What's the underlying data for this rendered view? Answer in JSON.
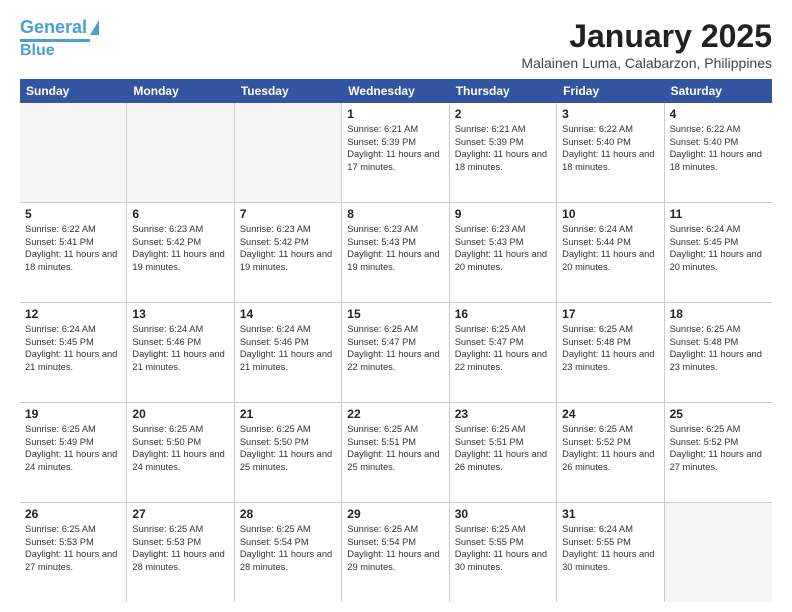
{
  "header": {
    "logo_line1": "General",
    "logo_line2": "Blue",
    "month_title": "January 2025",
    "subtitle": "Malainen Luma, Calabarzon, Philippines"
  },
  "days_of_week": [
    "Sunday",
    "Monday",
    "Tuesday",
    "Wednesday",
    "Thursday",
    "Friday",
    "Saturday"
  ],
  "weeks": [
    [
      {
        "day": "",
        "sunrise": "",
        "sunset": "",
        "daylight": "",
        "empty": true
      },
      {
        "day": "",
        "sunrise": "",
        "sunset": "",
        "daylight": "",
        "empty": true
      },
      {
        "day": "",
        "sunrise": "",
        "sunset": "",
        "daylight": "",
        "empty": true
      },
      {
        "day": "1",
        "sunrise": "Sunrise: 6:21 AM",
        "sunset": "Sunset: 5:39 PM",
        "daylight": "Daylight: 11 hours and 17 minutes.",
        "empty": false
      },
      {
        "day": "2",
        "sunrise": "Sunrise: 6:21 AM",
        "sunset": "Sunset: 5:39 PM",
        "daylight": "Daylight: 11 hours and 18 minutes.",
        "empty": false
      },
      {
        "day": "3",
        "sunrise": "Sunrise: 6:22 AM",
        "sunset": "Sunset: 5:40 PM",
        "daylight": "Daylight: 11 hours and 18 minutes.",
        "empty": false
      },
      {
        "day": "4",
        "sunrise": "Sunrise: 6:22 AM",
        "sunset": "Sunset: 5:40 PM",
        "daylight": "Daylight: 11 hours and 18 minutes.",
        "empty": false
      }
    ],
    [
      {
        "day": "5",
        "sunrise": "Sunrise: 6:22 AM",
        "sunset": "Sunset: 5:41 PM",
        "daylight": "Daylight: 11 hours and 18 minutes.",
        "empty": false
      },
      {
        "day": "6",
        "sunrise": "Sunrise: 6:23 AM",
        "sunset": "Sunset: 5:42 PM",
        "daylight": "Daylight: 11 hours and 19 minutes.",
        "empty": false
      },
      {
        "day": "7",
        "sunrise": "Sunrise: 6:23 AM",
        "sunset": "Sunset: 5:42 PM",
        "daylight": "Daylight: 11 hours and 19 minutes.",
        "empty": false
      },
      {
        "day": "8",
        "sunrise": "Sunrise: 6:23 AM",
        "sunset": "Sunset: 5:43 PM",
        "daylight": "Daylight: 11 hours and 19 minutes.",
        "empty": false
      },
      {
        "day": "9",
        "sunrise": "Sunrise: 6:23 AM",
        "sunset": "Sunset: 5:43 PM",
        "daylight": "Daylight: 11 hours and 20 minutes.",
        "empty": false
      },
      {
        "day": "10",
        "sunrise": "Sunrise: 6:24 AM",
        "sunset": "Sunset: 5:44 PM",
        "daylight": "Daylight: 11 hours and 20 minutes.",
        "empty": false
      },
      {
        "day": "11",
        "sunrise": "Sunrise: 6:24 AM",
        "sunset": "Sunset: 5:45 PM",
        "daylight": "Daylight: 11 hours and 20 minutes.",
        "empty": false
      }
    ],
    [
      {
        "day": "12",
        "sunrise": "Sunrise: 6:24 AM",
        "sunset": "Sunset: 5:45 PM",
        "daylight": "Daylight: 11 hours and 21 minutes.",
        "empty": false
      },
      {
        "day": "13",
        "sunrise": "Sunrise: 6:24 AM",
        "sunset": "Sunset: 5:46 PM",
        "daylight": "Daylight: 11 hours and 21 minutes.",
        "empty": false
      },
      {
        "day": "14",
        "sunrise": "Sunrise: 6:24 AM",
        "sunset": "Sunset: 5:46 PM",
        "daylight": "Daylight: 11 hours and 21 minutes.",
        "empty": false
      },
      {
        "day": "15",
        "sunrise": "Sunrise: 6:25 AM",
        "sunset": "Sunset: 5:47 PM",
        "daylight": "Daylight: 11 hours and 22 minutes.",
        "empty": false
      },
      {
        "day": "16",
        "sunrise": "Sunrise: 6:25 AM",
        "sunset": "Sunset: 5:47 PM",
        "daylight": "Daylight: 11 hours and 22 minutes.",
        "empty": false
      },
      {
        "day": "17",
        "sunrise": "Sunrise: 6:25 AM",
        "sunset": "Sunset: 5:48 PM",
        "daylight": "Daylight: 11 hours and 23 minutes.",
        "empty": false
      },
      {
        "day": "18",
        "sunrise": "Sunrise: 6:25 AM",
        "sunset": "Sunset: 5:48 PM",
        "daylight": "Daylight: 11 hours and 23 minutes.",
        "empty": false
      }
    ],
    [
      {
        "day": "19",
        "sunrise": "Sunrise: 6:25 AM",
        "sunset": "Sunset: 5:49 PM",
        "daylight": "Daylight: 11 hours and 24 minutes.",
        "empty": false
      },
      {
        "day": "20",
        "sunrise": "Sunrise: 6:25 AM",
        "sunset": "Sunset: 5:50 PM",
        "daylight": "Daylight: 11 hours and 24 minutes.",
        "empty": false
      },
      {
        "day": "21",
        "sunrise": "Sunrise: 6:25 AM",
        "sunset": "Sunset: 5:50 PM",
        "daylight": "Daylight: 11 hours and 25 minutes.",
        "empty": false
      },
      {
        "day": "22",
        "sunrise": "Sunrise: 6:25 AM",
        "sunset": "Sunset: 5:51 PM",
        "daylight": "Daylight: 11 hours and 25 minutes.",
        "empty": false
      },
      {
        "day": "23",
        "sunrise": "Sunrise: 6:25 AM",
        "sunset": "Sunset: 5:51 PM",
        "daylight": "Daylight: 11 hours and 26 minutes.",
        "empty": false
      },
      {
        "day": "24",
        "sunrise": "Sunrise: 6:25 AM",
        "sunset": "Sunset: 5:52 PM",
        "daylight": "Daylight: 11 hours and 26 minutes.",
        "empty": false
      },
      {
        "day": "25",
        "sunrise": "Sunrise: 6:25 AM",
        "sunset": "Sunset: 5:52 PM",
        "daylight": "Daylight: 11 hours and 27 minutes.",
        "empty": false
      }
    ],
    [
      {
        "day": "26",
        "sunrise": "Sunrise: 6:25 AM",
        "sunset": "Sunset: 5:53 PM",
        "daylight": "Daylight: 11 hours and 27 minutes.",
        "empty": false
      },
      {
        "day": "27",
        "sunrise": "Sunrise: 6:25 AM",
        "sunset": "Sunset: 5:53 PM",
        "daylight": "Daylight: 11 hours and 28 minutes.",
        "empty": false
      },
      {
        "day": "28",
        "sunrise": "Sunrise: 6:25 AM",
        "sunset": "Sunset: 5:54 PM",
        "daylight": "Daylight: 11 hours and 28 minutes.",
        "empty": false
      },
      {
        "day": "29",
        "sunrise": "Sunrise: 6:25 AM",
        "sunset": "Sunset: 5:54 PM",
        "daylight": "Daylight: 11 hours and 29 minutes.",
        "empty": false
      },
      {
        "day": "30",
        "sunrise": "Sunrise: 6:25 AM",
        "sunset": "Sunset: 5:55 PM",
        "daylight": "Daylight: 11 hours and 30 minutes.",
        "empty": false
      },
      {
        "day": "31",
        "sunrise": "Sunrise: 6:24 AM",
        "sunset": "Sunset: 5:55 PM",
        "daylight": "Daylight: 11 hours and 30 minutes.",
        "empty": false
      },
      {
        "day": "",
        "sunrise": "",
        "sunset": "",
        "daylight": "",
        "empty": true
      }
    ]
  ]
}
